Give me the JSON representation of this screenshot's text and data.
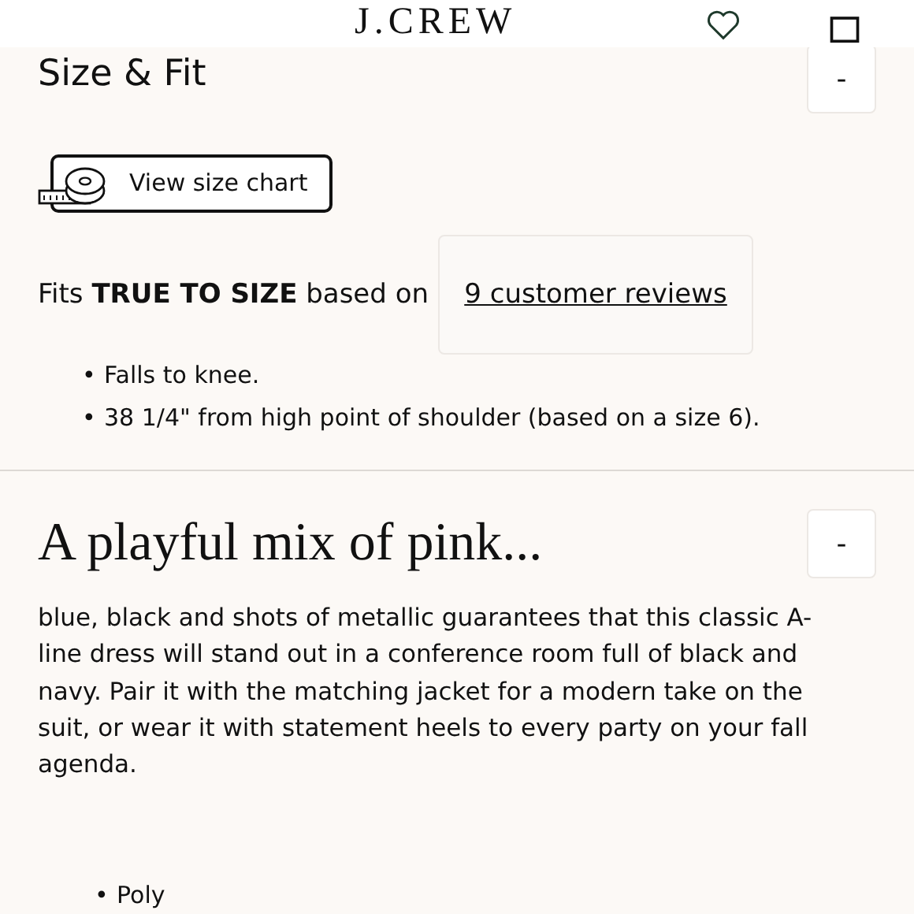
{
  "header": {
    "logo": "J.CREW"
  },
  "size_fit": {
    "title": "Size & Fit",
    "toggle": "-",
    "size_chart_button": "View size chart",
    "fit_text": "Fits **TRUE TO SIZE** based on",
    "reviews_link": "9 customer reviews",
    "details": [
      {
        "bullet": "•",
        "text": "Falls to knee."
      },
      {
        "bullet": "•",
        "text": "38 1/4\" from high point of shoulder (based on a size 6)."
      }
    ]
  },
  "description": {
    "title": "A playful mix of pink...",
    "toggle": "-",
    "text": "blue, black and shots of metallic guarantees that this classic A-line dress will stand out in a conference room full of black and navy. Pair it with the matching jacket for a modern take on the suit, or wear it with statement heels to every party on your fall agenda.",
    "materials": [
      {
        "bullet": "•",
        "text": "Poly"
      }
    ]
  }
}
